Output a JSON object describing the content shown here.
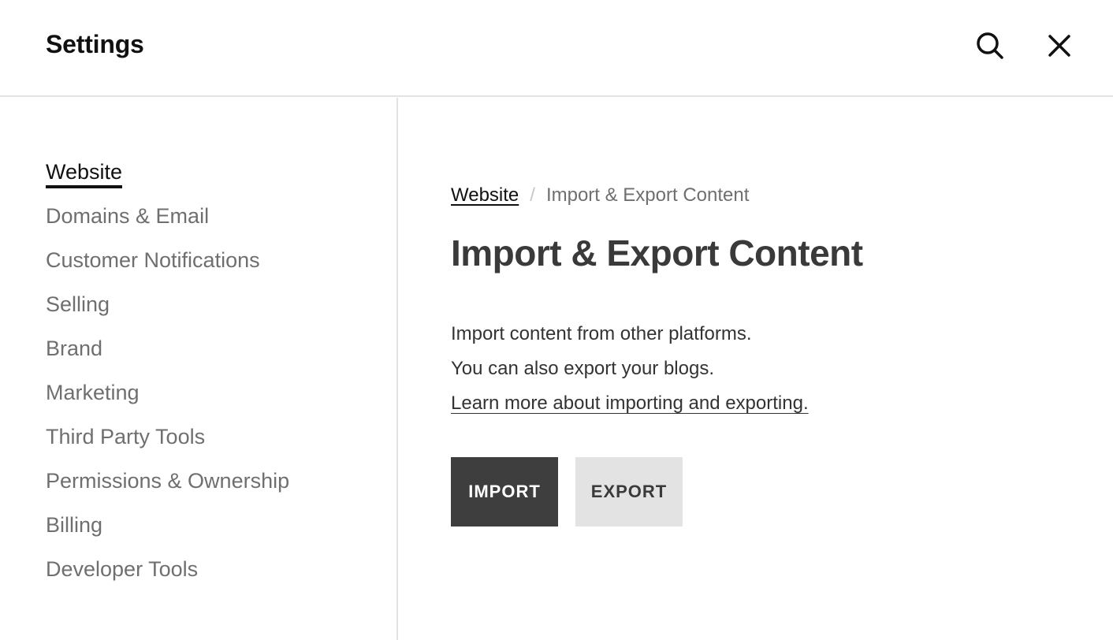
{
  "header": {
    "title": "Settings",
    "search_icon": "search-icon",
    "close_icon": "close-icon"
  },
  "sidebar": {
    "items": [
      {
        "label": "Website",
        "active": true
      },
      {
        "label": "Domains & Email"
      },
      {
        "label": "Customer Notifications"
      },
      {
        "label": "Selling"
      },
      {
        "label": "Brand"
      },
      {
        "label": "Marketing"
      },
      {
        "label": "Third Party Tools"
      },
      {
        "label": "Permissions & Ownership"
      },
      {
        "label": "Billing"
      },
      {
        "label": "Developer Tools"
      }
    ]
  },
  "main": {
    "breadcrumb": {
      "parent": "Website",
      "separator": "/",
      "current": "Import & Export Content"
    },
    "title": "Import & Export Content",
    "description_line1": "Import content from other platforms.",
    "description_line2": "You can also export your blogs.",
    "learn_more": "Learn more about importing and exporting.",
    "import_label": "IMPORT",
    "export_label": "EXPORT"
  },
  "colors": {
    "primary_button": "#3e3e3e",
    "secondary_button": "#e3e3e3",
    "muted_text": "#6f6f6f",
    "divider": "#e3e3e3"
  }
}
